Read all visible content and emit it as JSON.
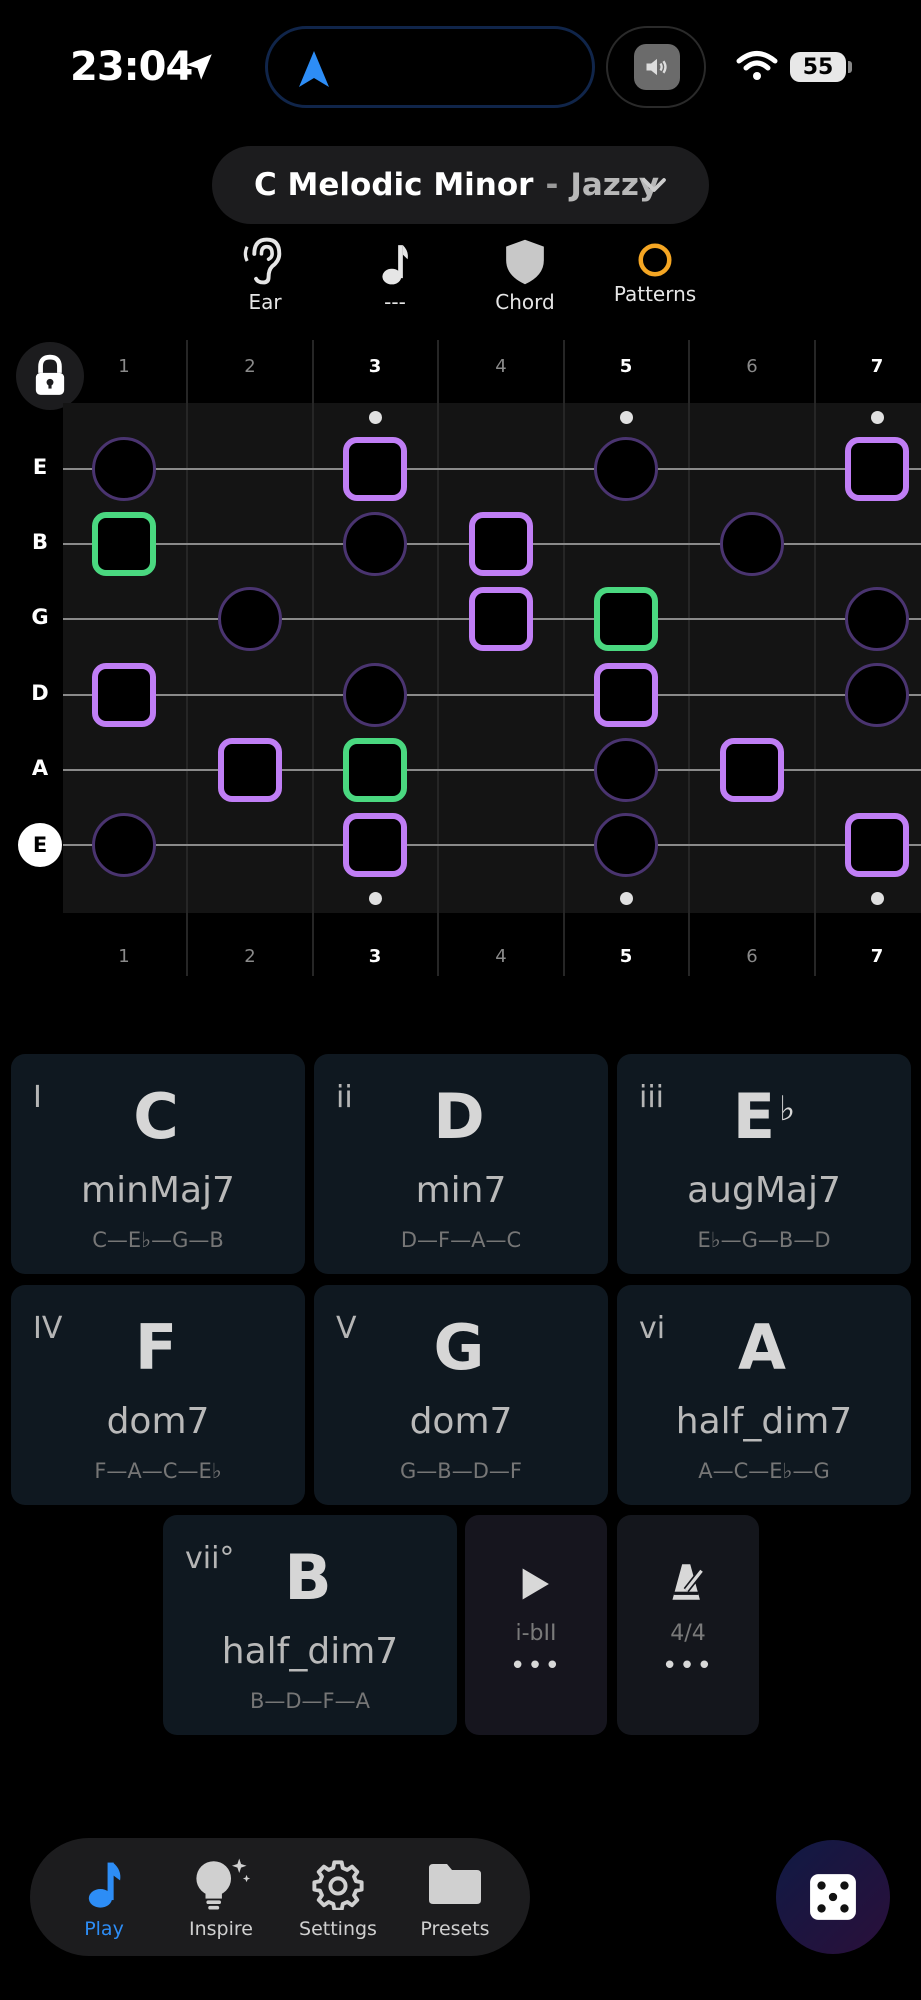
{
  "status_bar": {
    "time": "23:04",
    "battery": "55"
  },
  "scale_selector": {
    "scale": "C Melodic Minor",
    "separator": "-",
    "style": "Jazzy"
  },
  "modes": [
    {
      "label": "Ear",
      "icon": "ear-icon"
    },
    {
      "label": "---",
      "icon": "music-note-icon"
    },
    {
      "label": "Chord",
      "icon": "shield-icon"
    },
    {
      "label": "Patterns",
      "icon": "circle-outline-icon"
    }
  ],
  "fretboard": {
    "fret_numbers": [
      "1",
      "2",
      "3",
      "4",
      "5",
      "6",
      "7"
    ],
    "strings": [
      "E",
      "B",
      "G",
      "D",
      "A",
      "E"
    ],
    "colors": {
      "chord_tone": "#c07ef5",
      "root": "#4ad880",
      "scale_tone": "#4a3470"
    }
  },
  "chords": [
    {
      "numeral": "I",
      "root": "C",
      "accidental": "",
      "quality": "minMaj7",
      "notes": "C—E♭—G—B"
    },
    {
      "numeral": "ii",
      "root": "D",
      "accidental": "",
      "quality": "min7",
      "notes": "D—F—A—C"
    },
    {
      "numeral": "iii",
      "root": "E",
      "accidental": "♭",
      "quality": "augMaj7",
      "notes": "E♭—G—B—D"
    },
    {
      "numeral": "IV",
      "root": "F",
      "accidental": "",
      "quality": "dom7",
      "notes": "F—A—C—E♭"
    },
    {
      "numeral": "V",
      "root": "G",
      "accidental": "",
      "quality": "dom7",
      "notes": "G—B—D—F"
    },
    {
      "numeral": "vi",
      "root": "A",
      "accidental": "",
      "quality": "half_dim7",
      "notes": "A—C—E♭—G"
    },
    {
      "numeral": "vii°",
      "root": "B",
      "accidental": "",
      "quality": "half_dim7",
      "notes": "B—D—F—A"
    }
  ],
  "progression": {
    "label": "i-bII",
    "more": "•••"
  },
  "metronome": {
    "label": "4/4",
    "more": "•••"
  },
  "tabs": [
    {
      "label": "Play",
      "icon": "music-note-icon"
    },
    {
      "label": "Inspire",
      "icon": "lightbulb-icon"
    },
    {
      "label": "Settings",
      "icon": "gear-icon"
    },
    {
      "label": "Presets",
      "icon": "folder-icon"
    }
  ]
}
